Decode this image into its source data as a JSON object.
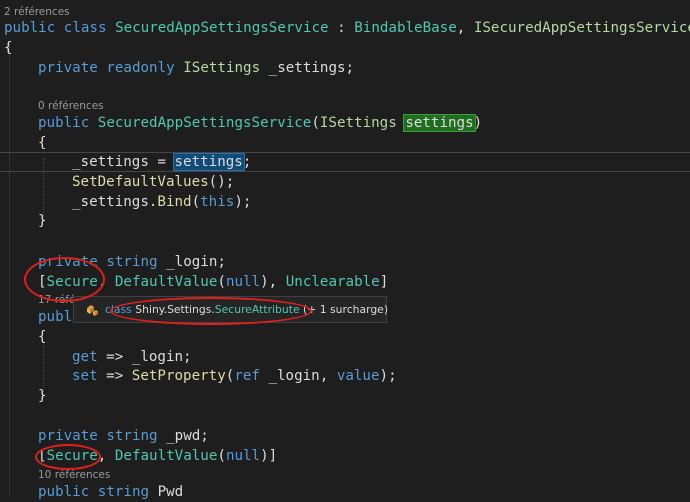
{
  "codelens": {
    "class_refs": "2 références",
    "ctor_refs": "0 références",
    "login_refs": "17 réfé",
    "pwd_refs": "10 références"
  },
  "code": {
    "class_public": "public",
    "class_class": "class",
    "class_name": "SecuredAppSettingsService",
    "class_colon": " : ",
    "class_base1": "BindableBase",
    "class_comma": ", ",
    "class_base2": "ISecuredAppSettingsService",
    "open_brace": "{",
    "close_brace": "}",
    "field_private": "private",
    "field_readonly": "readonly",
    "field_type": "ISettings",
    "field_name": " _settings;",
    "ctor_public": "public",
    "ctor_name": "SecuredAppSettingsService",
    "ctor_paren_open": "(",
    "ctor_param_type": "ISettings",
    "ctor_param_name": "settings",
    "ctor_paren_close": ")",
    "assign_lhs": "_settings = ",
    "assign_rhs": "settings",
    "assign_end": ";",
    "call_set_defaults": "SetDefaultValues",
    "call_set_defaults_args": "();",
    "bind_prefix": "_settings.",
    "bind_name": "Bind",
    "bind_open": "(",
    "bind_this": "this",
    "bind_close": ");",
    "login_private": "private",
    "login_string": "string",
    "login_name": " _login;",
    "attr_open": "[",
    "attr_secure": "Secure",
    "attr_comma": ", ",
    "attr_default": "DefaultValue",
    "attr_paren_open": "(",
    "attr_null": "null",
    "attr_paren_close": ")",
    "attr_unclearable": "Unclearable",
    "attr_close": "]",
    "attr_close_pwd": ")]",
    "prop_partial": "publ",
    "get_kw": "get",
    "get_body": " => _login;",
    "set_kw": "set",
    "set_arrow": " => ",
    "set_call": "SetProperty",
    "set_open": "(",
    "set_ref": "ref",
    "set_mid": " _login, ",
    "set_value": "value",
    "set_close": ");",
    "pwd_private": "private",
    "pwd_string": "string",
    "pwd_name": " _pwd;",
    "pwd_public": "public",
    "pwd_type": "string",
    "pwd_prop": " Pwd"
  },
  "tooltip": {
    "icon": "class-icon",
    "kw": "class",
    "ns": " Shiny.Settings.",
    "type": "SecureAttribute",
    "suffix": " (+ 1 surcharge)"
  },
  "colors": {
    "background": "#1e1e1e",
    "keyword": "#569cd6",
    "type": "#4ec9b0",
    "method": "#dcdcaa",
    "plain": "#dcdcdc",
    "annotation_ring": "#e0201a"
  }
}
